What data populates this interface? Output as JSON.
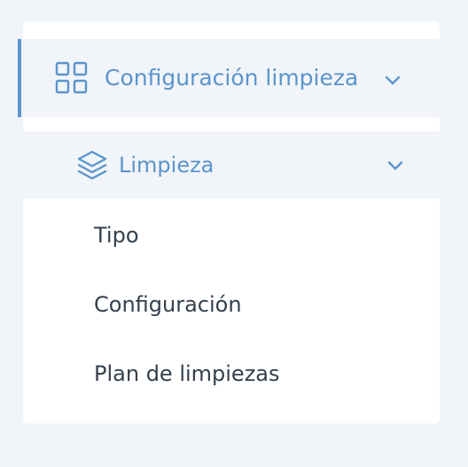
{
  "colors": {
    "accent": "#5b95cc",
    "text": "#34404d",
    "background": "#f1f4f8",
    "card": "#ffffff"
  },
  "menu": {
    "parent": {
      "label": "Configuración limpieza",
      "icon": "grid-icon",
      "chevron": "chevron-down-icon"
    },
    "sub": {
      "label": "Limpieza",
      "icon": "layers-icon",
      "chevron": "chevron-down-icon"
    },
    "items": [
      {
        "label": "Tipo"
      },
      {
        "label": "Configuración"
      },
      {
        "label": "Plan de limpiezas"
      }
    ]
  }
}
